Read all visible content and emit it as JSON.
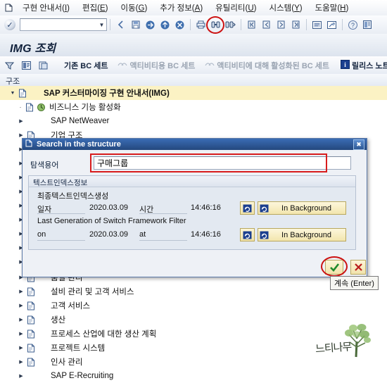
{
  "menubar": {
    "system_icon": "sap-system-menu-icon",
    "items": [
      {
        "label": "구현 안내서(",
        "mn": "I",
        "tail": ")"
      },
      {
        "label": "편집(",
        "mn": "E",
        "tail": ")"
      },
      {
        "label": "이동(",
        "mn": "G",
        "tail": ")"
      },
      {
        "label": "추가 정보(",
        "mn": "A",
        "tail": ")"
      },
      {
        "label": "유틸리티(",
        "mn": "U",
        "tail": ")"
      },
      {
        "label": "시스템(",
        "mn": "Y",
        "tail": ")"
      },
      {
        "label": "도움말(",
        "mn": "H",
        "tail": ")"
      }
    ]
  },
  "toolbar": {
    "enter_icon": "enter-check-icon",
    "command_field_value": "",
    "command_field_placeholder": "",
    "dropdown_icon": "chevron-down-icon",
    "buttons": [
      {
        "name": "back-icon",
        "tip": "Back"
      },
      {
        "name": "save-icon",
        "tip": "Save"
      },
      {
        "name": "exit-icon",
        "tip": "Exit"
      },
      {
        "name": "cancel-icon",
        "tip": "Cancel"
      },
      {
        "name": "print-icon",
        "tip": "Print"
      },
      {
        "name": "find-icon",
        "tip": "Find",
        "highlighted": true
      },
      {
        "name": "find-next-icon",
        "tip": "Find Next"
      },
      {
        "name": "first-page-icon",
        "tip": "First Page"
      },
      {
        "name": "previous-page-icon",
        "tip": "Previous Page"
      },
      {
        "name": "next-page-icon",
        "tip": "Next Page"
      },
      {
        "name": "last-page-icon",
        "tip": "Last Page"
      },
      {
        "name": "create-session-icon",
        "tip": "Create Session"
      },
      {
        "name": "shortcut-icon",
        "tip": "Create Shortcut"
      },
      {
        "name": "help-icon",
        "tip": "Help"
      },
      {
        "name": "layout-menu-icon",
        "tip": "Customize Local Layout"
      }
    ]
  },
  "title_band": {
    "title": "IMG 조회"
  },
  "app_toolbar": {
    "icon_buttons": [
      {
        "name": "filter-icon"
      },
      {
        "name": "display-structure-icon"
      },
      {
        "name": "documentation-icon"
      }
    ],
    "items": [
      {
        "label": "기존 BC 세트",
        "icon": "bcset-existing-icon",
        "disabled": false
      },
      {
        "label": "액티비티용 BC 세트",
        "icon": "bcset-activity-icon",
        "disabled": true
      },
      {
        "label": "액티비티에 대해 활성화된 BC 세트",
        "icon": "bcset-active-icon",
        "disabled": true
      },
      {
        "label": "릴리스 노트",
        "icon": "release-note-icon",
        "disabled": false
      }
    ]
  },
  "tree": {
    "header": "구조",
    "root": {
      "label": "SAP 커스터마이징 구현 안내서(IMG)",
      "expanded": true
    },
    "nodes_top": [
      {
        "label": "비즈니스 기능 활성화",
        "leaf": true,
        "has_activity_icon": true
      },
      {
        "label": "SAP NetWeaver",
        "leaf": false,
        "has_doc_icon": false
      },
      {
        "label": "기업 구조",
        "leaf": false,
        "has_doc_icon": true
      }
    ],
    "nodes_bottom": [
      {
        "label": "품질 관리"
      },
      {
        "label": "설비 관리 및 고객 서비스"
      },
      {
        "label": "고객 서비스"
      },
      {
        "label": "생산"
      },
      {
        "label": "프로세스 산업에 대한 생산 계획"
      },
      {
        "label": "프로젝트 시스템"
      },
      {
        "label": "인사 관리"
      },
      {
        "label": "SAP E-Recruiting",
        "no_doc_icon": true
      }
    ]
  },
  "dialog": {
    "title": "Search in the structure",
    "title_icon": "sap-window-icon",
    "close_icon": "close-icon",
    "search": {
      "label": "탐색용어",
      "value": "구매그룹",
      "placeholder": ""
    },
    "groupbox": {
      "title": "텍스트인덱스정보",
      "subtitle": "최종텍스트인덱스생성",
      "row1": {
        "date_label": "일자",
        "date_value": "2020.03.09",
        "time_label": "시간",
        "time_value": "14:46:16",
        "refresh_icon": "refresh-icon",
        "background_button": "In Background"
      },
      "section2_title": "Last Generation of Switch Framework Filter",
      "row2": {
        "date_label": "on",
        "date_value": "2020.03.09",
        "time_label": "at",
        "time_value": "14:46:16",
        "refresh_icon": "refresh-icon",
        "background_button": "In Background"
      }
    },
    "footer": {
      "ok_icon": "green-check-icon",
      "cancel_icon": "red-x-icon",
      "tooltip": "계속  (Enter)"
    }
  },
  "watermark": {
    "text": "느티나무",
    "icon": "tree-drawing-icon"
  },
  "colors": {
    "accent_blue": "#24487e",
    "highlight_red": "#cc1111",
    "row_highlight": "#fbf2c4",
    "button_yellow": "#f2e5ad"
  }
}
